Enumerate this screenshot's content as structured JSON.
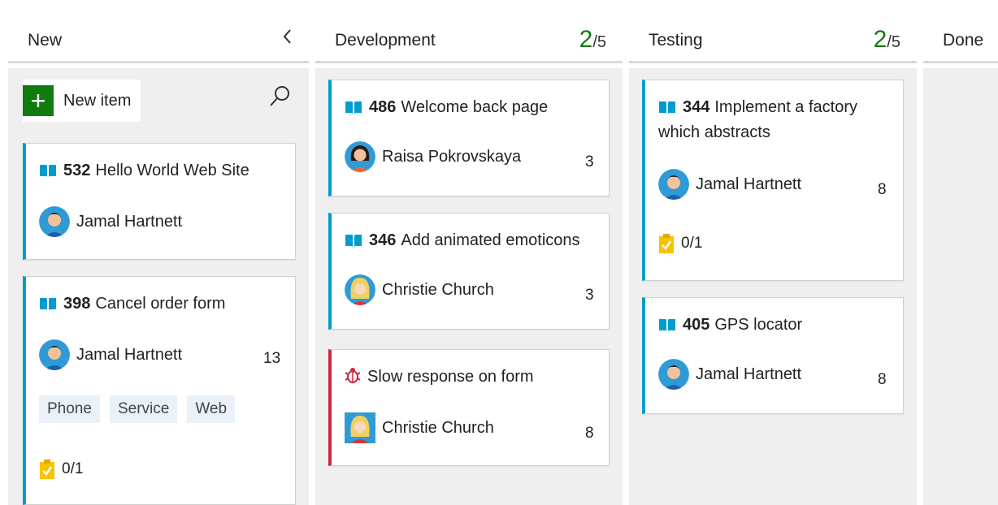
{
  "columns": [
    {
      "title": "New",
      "collapse_icon": "chevron-left-icon"
    },
    {
      "title": "Development",
      "count": "2",
      "limit": "/5"
    },
    {
      "title": "Testing",
      "count": "2",
      "limit": "/5"
    },
    {
      "title": "Done"
    }
  ],
  "new_column": {
    "new_item_label": "New item",
    "plus_icon": "plus-icon",
    "search_icon": "search-icon"
  },
  "cards": {
    "c532": {
      "id": "532",
      "title": "Hello World Web Site",
      "assignee": "Jamal Hartnett",
      "type_icon": "user-story-icon"
    },
    "c398": {
      "id": "398",
      "title": "Cancel order form",
      "assignee": "Jamal Hartnett",
      "effort": "13",
      "tags": [
        "Phone",
        "Service",
        "Web"
      ],
      "tasks": "0/1",
      "type_icon": "user-story-icon"
    },
    "c486": {
      "id": "486",
      "title": "Welcome back page",
      "assignee": "Raisa Pokrovskaya",
      "effort": "3",
      "type_icon": "user-story-icon"
    },
    "c346": {
      "id": "346",
      "title": "Add animated emoticons",
      "assignee": "Christie Church",
      "effort": "3",
      "type_icon": "user-story-icon"
    },
    "cbug": {
      "title": "Slow response on form",
      "assignee": "Christie Church",
      "effort": "8",
      "type_icon": "bug-icon"
    },
    "c344": {
      "id": "344",
      "title_line1": "Implement a factory",
      "title_line2": "which abstracts",
      "assignee": "Jamal Hartnett",
      "effort": "8",
      "tasks": "0/1",
      "type_icon": "user-story-icon"
    },
    "c405": {
      "id": "405",
      "title": "GPS locator",
      "assignee": "Jamal Hartnett",
      "effort": "8",
      "type_icon": "user-story-icon"
    }
  },
  "colors": {
    "story_accent": "#009ccc",
    "bug_accent": "#cc293d",
    "count_green": "#107c10",
    "task_yellow": "#f8c400",
    "tag_bg": "#eaf1f8"
  }
}
